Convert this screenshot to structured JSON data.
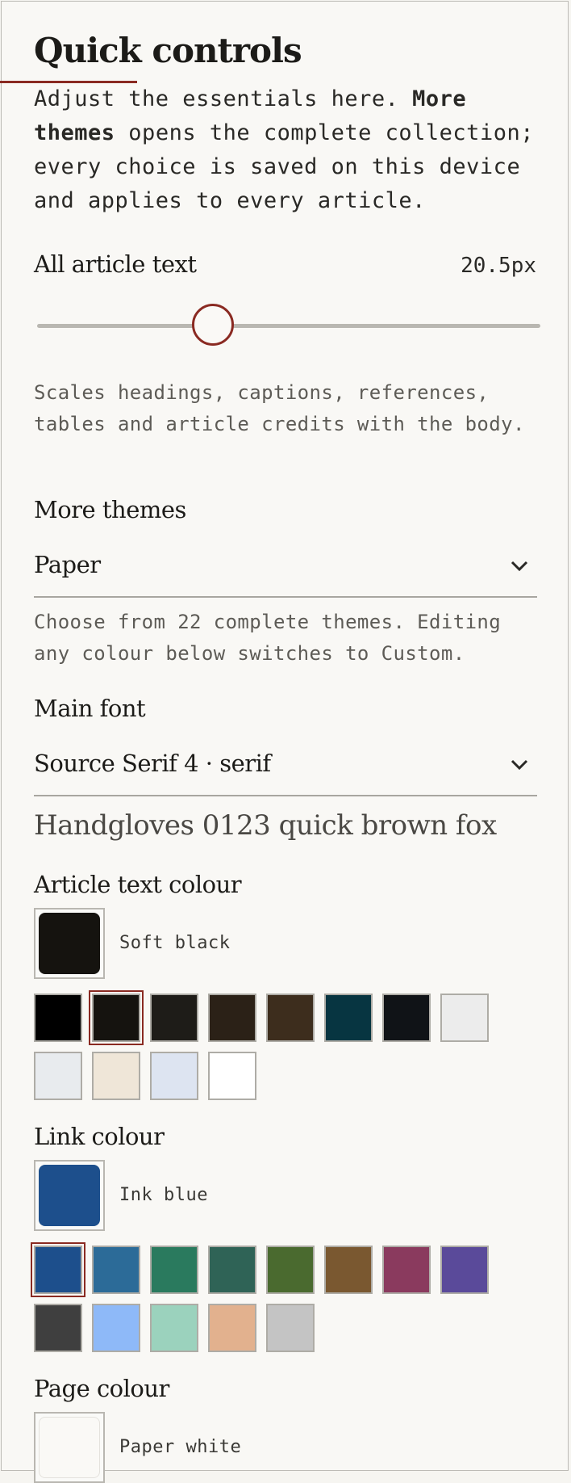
{
  "panel": {
    "title": "Quick controls",
    "intro_lead": "Adjust the essentials here. ",
    "intro_bold": "More themes",
    "intro_tail": " opens the complete collection; every choice is saved on this device and applies to every article.",
    "accent_color": "#8a2a22"
  },
  "text_size": {
    "label": "All article text",
    "value_text": "20.5px",
    "slider_fraction": 0.35,
    "hint": "Scales headings, captions, references, tables and article credits with the body."
  },
  "themes": {
    "label": "More themes",
    "selected": "Paper",
    "hint": "Choose from 22 complete themes. Editing any colour below switches to Custom.",
    "icon": "chevron-down-icon"
  },
  "font": {
    "label": "Main font",
    "selected": "Source Serif 4 · serif",
    "preview": "Handgloves 0123 quick brown fox",
    "icon": "chevron-down-icon"
  },
  "text_colour": {
    "label": "Article text colour",
    "current_name": "Soft black",
    "current_color": "#15130f",
    "selected_index": 1,
    "swatches": [
      "#000000",
      "#15130f",
      "#1e1c18",
      "#2b2117",
      "#3d2d1d",
      "#073541",
      "#101317",
      "#ececec",
      "#e8ebee",
      "#efe6d8",
      "#dde4f1",
      "#ffffff"
    ]
  },
  "link_colour": {
    "label": "Link colour",
    "current_name": "Ink blue",
    "current_color": "#1d4f8c",
    "selected_index": 0,
    "swatches": [
      "#1d4f8c",
      "#2c6b98",
      "#2a7a5e",
      "#2f6356",
      "#4a6a2f",
      "#7a5830",
      "#8a3a5e",
      "#5a4a9a",
      "#3f3f3f",
      "#8eb9f8",
      "#9bd2bd",
      "#e2b18e",
      "#c4c4c4"
    ]
  },
  "page_colour": {
    "label": "Page colour",
    "current_name": "Paper white",
    "current_color": "#faf9f6"
  }
}
